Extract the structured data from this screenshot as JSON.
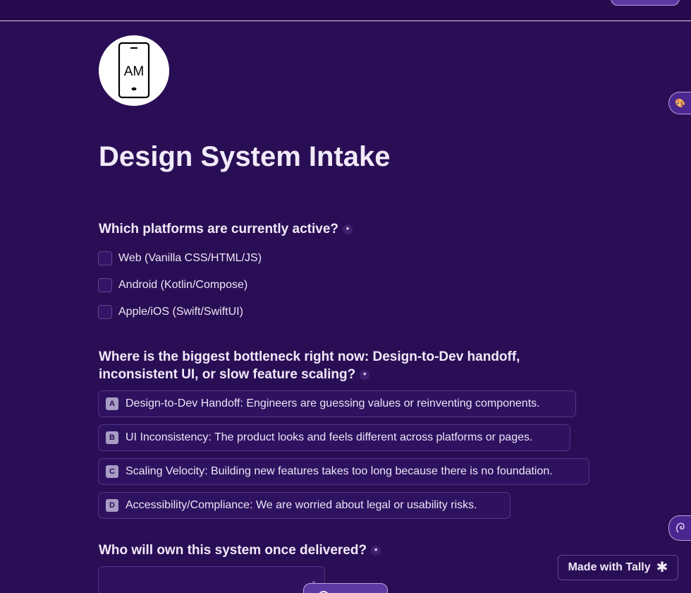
{
  "form": {
    "title": "Design System Intake",
    "logo_text": "AM",
    "required_mark": "*"
  },
  "questions": [
    {
      "label": "Which platforms are currently active?",
      "type": "checkbox",
      "options": [
        "Web (Vanilla CSS/HTML/JS)",
        "Android (Kotlin/Compose)",
        "Apple/iOS (Swift/SwiftUI)"
      ]
    },
    {
      "label_line1": "Where is the biggest bottleneck right now: Design-to-Dev handoff,",
      "label_line2": "inconsistent UI, or slow feature scaling?",
      "type": "multiple-choice",
      "options": [
        {
          "key": "A",
          "label": "Design-to-Dev Handoff: Engineers are guessing values or reinventing components."
        },
        {
          "key": "B",
          "label": "UI Inconsistency: The product looks and feels different across platforms or pages."
        },
        {
          "key": "C",
          "label": "Scaling Velocity: Building new features takes too long because there is no foundation."
        },
        {
          "key": "D",
          "label": "Accessibility/Compliance: We are worried about legal or usability risks."
        }
      ]
    },
    {
      "label": "Who will own this system once delivered?",
      "type": "dropdown",
      "value": ""
    }
  ],
  "branding": {
    "badge_label": "Made with Tally",
    "badge_icon": "tally-asterisk-icon"
  },
  "icons": {
    "palette_tab": "palette-icon",
    "feedback_tab": "feedback-icon",
    "dropdown": "chevron-down-icon"
  },
  "colors": {
    "background": "#2a0e55",
    "accent": "#5c3aa3",
    "text": "#f1eaf9"
  }
}
